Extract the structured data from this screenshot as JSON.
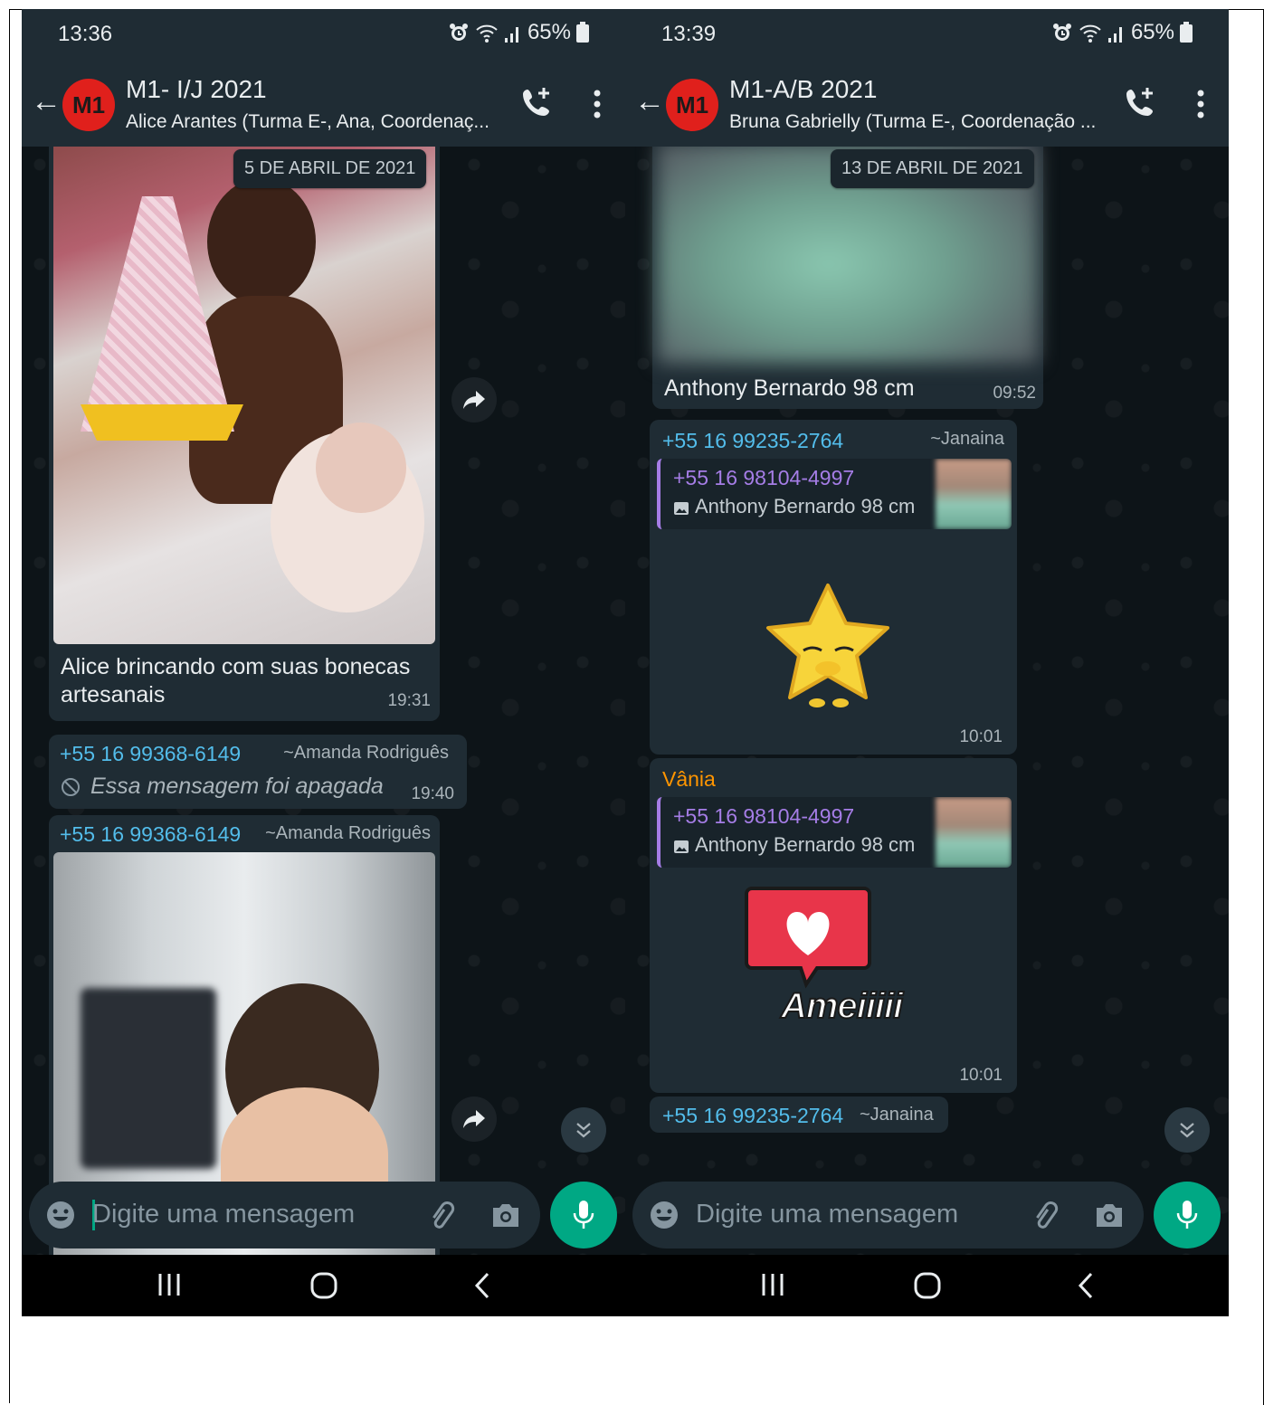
{
  "left": {
    "status": {
      "time": "13:36",
      "battery": "65%"
    },
    "header": {
      "avatar_text": "M1",
      "title": "M1- I/J 2021",
      "subtitle": "Alice Arantes (Turma E-, Ana, Coordenaç..."
    },
    "date_chip": "5 DE ABRIL DE 2021",
    "messages": [
      {
        "caption": "Alice brincando com suas bonecas artesanais",
        "time": "19:31"
      },
      {
        "sender": "+55 16 99368-6149",
        "alias": "~Amanda Rodriguês",
        "deleted_text": "Essa mensagem foi apagada",
        "time": "19:40"
      },
      {
        "sender": "+55 16 99368-6149",
        "alias": "~Amanda Rodriguês"
      }
    ],
    "input": {
      "placeholder": "Digite uma mensagem"
    }
  },
  "right": {
    "status": {
      "time": "13:39",
      "battery": "65%"
    },
    "header": {
      "avatar_text": "M1",
      "title": "M1-A/B 2021",
      "subtitle": "Bruna Gabrielly (Turma E-, Coordenação ..."
    },
    "date_chip": "13 DE ABRIL DE 2021",
    "messages": [
      {
        "caption": "Anthony Bernardo 98 cm",
        "time": "09:52"
      },
      {
        "sender": "+55 16 99235-2764",
        "alias": "~Janaina",
        "quote_name": "+55 16 98104-4997",
        "quote_text": "Anthony Bernardo 98 cm",
        "time": "10:01"
      },
      {
        "sender": "Vânia",
        "quote_name": "+55 16 98104-4997",
        "quote_text": "Anthony Bernardo 98 cm",
        "sticker_text": "Ameiiiii",
        "time": "10:01"
      },
      {
        "sender": "+55 16 99235-2764",
        "alias": "~Janaina"
      }
    ],
    "input": {
      "placeholder": "Digite uma mensagem"
    }
  },
  "colors": {
    "accent": "#00a884",
    "bubble": "#1f2c34",
    "header": "#1f2c34",
    "sender_blue": "#53bdeb",
    "sender_orange": "#ff9500",
    "quote_purple": "#a57de6"
  }
}
